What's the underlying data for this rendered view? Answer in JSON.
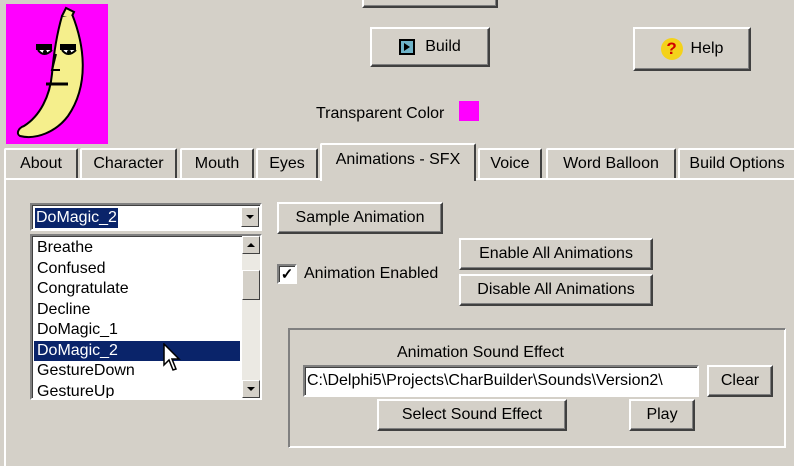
{
  "toolbar": {
    "build_label": "Build",
    "help_label": "Help",
    "transparent_color_label": "Transparent Color",
    "transparent_color": "#ff00ff"
  },
  "tabs": [
    "About",
    "Character",
    "Mouth",
    "Eyes",
    "Animations - SFX",
    "Voice",
    "Word Balloon",
    "Build Options"
  ],
  "active_tab": "Animations - SFX",
  "animations": {
    "dropdown_value": "DoMagic_2",
    "list_items": [
      "Breathe",
      "Confused",
      "Congratulate",
      "Decline",
      "DoMagic_1",
      "DoMagic_2",
      "GestureDown",
      "GestureUp"
    ],
    "selected_item": "DoMagic_2",
    "sample_label": "Sample Animation",
    "enabled_label": "Animation Enabled",
    "enabled_checked": true,
    "enable_all_label": "Enable All Animations",
    "disable_all_label": "Disable All Animations"
  },
  "sound": {
    "group_label": "Animation Sound Effect",
    "path_value": "C:\\Delphi5\\Projects\\CharBuilder\\Sounds\\Version2\\",
    "clear_label": "Clear",
    "select_label": "Select Sound Effect",
    "play_label": "Play"
  },
  "colors": {
    "selection": "#0a246a",
    "face": "#d4d0c8",
    "preview_bg": "#ff00ff",
    "banana": "#f5ef8c"
  }
}
